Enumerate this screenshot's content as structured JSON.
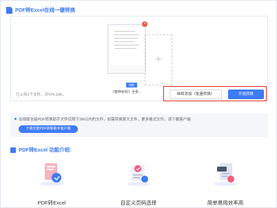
{
  "header": {
    "title": "PDF转Excel在线一键转换"
  },
  "upload": {
    "file_badge": "转换",
    "file_name": "《春种秋收》全景...",
    "file_close": "×",
    "add_plus": "+",
    "status_text": "已上传1个文件，共474.30K。",
    "continue_label": "继续添加（批量转换）",
    "start_label": "开始转换"
  },
  "notice": {
    "text": "在线版全能PDF转换助手文件仅限于2M以内的文件，如需转换更大文件，更多格式文件，请下载客户端",
    "button_label": "下载全能PDF转换助手客户端"
  },
  "intro": {
    "title": "PDF转Excel 功能介绍:",
    "features": [
      {
        "label": "PDF转Excel",
        "icon": "pdf-to-excel-icon"
      },
      {
        "label": "自定义页码选择",
        "icon": "custom-page-icon"
      },
      {
        "label": "简单易用效率高",
        "icon": "easy-efficient-icon"
      }
    ]
  },
  "colors": {
    "accent": "#3d7bf7",
    "highlight": "#e0261f"
  }
}
